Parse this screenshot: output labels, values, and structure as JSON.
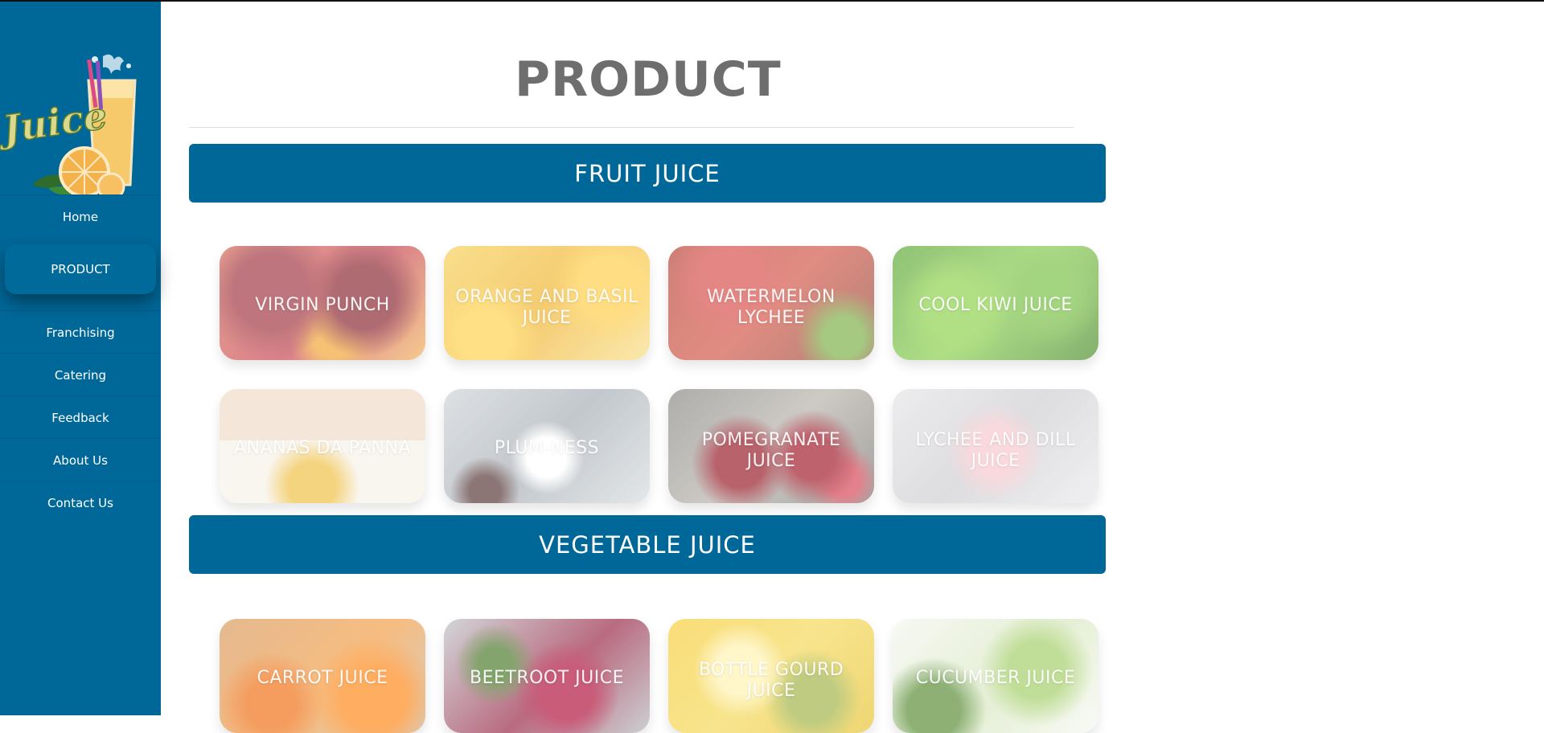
{
  "sidebar": {
    "logo_text": "Juice",
    "items": [
      {
        "label": "Home"
      },
      {
        "label": "PRODUCT"
      },
      {
        "label": "Franchising"
      },
      {
        "label": "Catering"
      },
      {
        "label": "Feedback"
      },
      {
        "label": "About Us"
      },
      {
        "label": "Contact Us"
      }
    ],
    "active": "PRODUCT"
  },
  "page": {
    "title": "PRODUCT"
  },
  "sections": [
    {
      "title": "FRUIT JUICE",
      "products": [
        {
          "name": "VIRGIN PUNCH"
        },
        {
          "name": "ORANGE AND BASIL JUICE"
        },
        {
          "name": "WATERMELON LYCHEE"
        },
        {
          "name": "COOL KIWI JUICE"
        },
        {
          "name": "ANANAS DA PANNA"
        },
        {
          "name": "PLUM-NESS"
        },
        {
          "name": "POMEGRANATE JUICE"
        },
        {
          "name": "LYCHEE AND DILL JUICE"
        }
      ]
    },
    {
      "title": "VEGETABLE JUICE",
      "products": [
        {
          "name": "CARROT JUICE"
        },
        {
          "name": "BEETROOT JUICE"
        },
        {
          "name": "BOTTLE GOURD JUICE"
        },
        {
          "name": "CUCUMBER JUICE"
        }
      ]
    }
  ],
  "colors": {
    "brand_blue": "#006899",
    "title_gray": "#6e6e6e",
    "text_white": "#ffffff"
  }
}
